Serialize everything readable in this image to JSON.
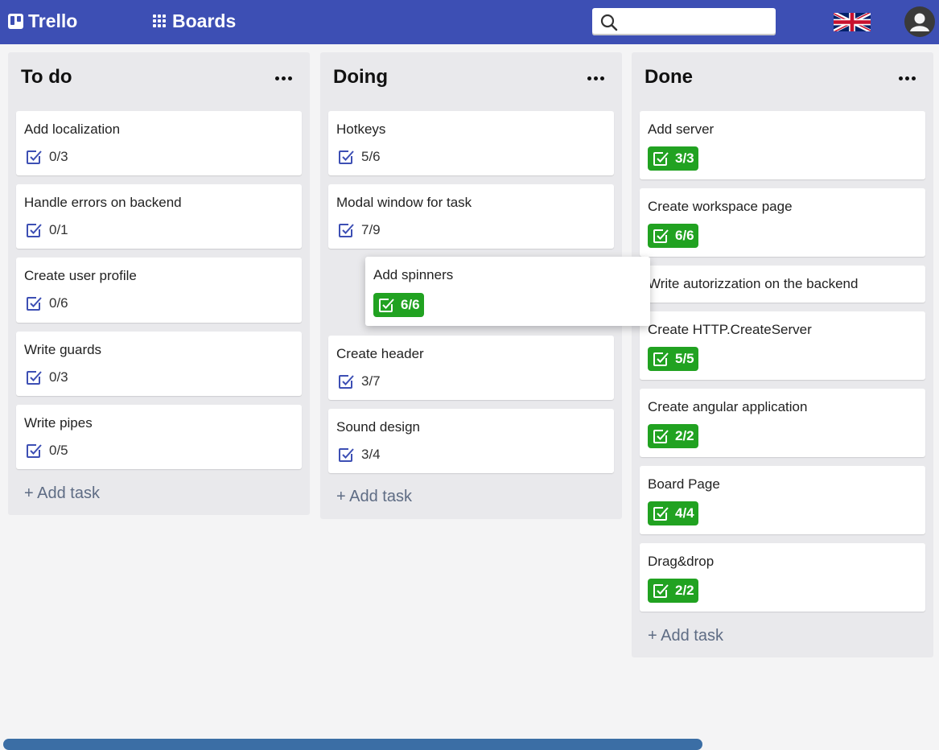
{
  "header": {
    "logo": "Trello",
    "boards": "Boards",
    "search": {
      "value": "",
      "placeholder": ""
    },
    "language_icon": "uk-flag-icon",
    "avatar_icon": "user-avatar-icon",
    "color": "#3d4fb4"
  },
  "columns": [
    {
      "title": "To do",
      "cards": [
        {
          "title": "Add localization",
          "progress": "0/3"
        },
        {
          "title": "Handle errors on backend",
          "progress": "0/1"
        },
        {
          "title": "Create user profile",
          "progress": "0/6"
        },
        {
          "title": "Write guards",
          "progress": "0/3"
        },
        {
          "title": "Write pipes",
          "progress": "0/5"
        }
      ],
      "add_task": "+ Add task"
    },
    {
      "title": "Doing",
      "cards": [
        {
          "title": "Hotkeys",
          "progress": "5/6"
        },
        {
          "title": "Modal window for task",
          "progress": "7/9"
        },
        {
          "title": "Create header",
          "progress": "3/7"
        },
        {
          "title": "Sound design",
          "progress": "3/4"
        }
      ],
      "add_task": "+ Add task"
    },
    {
      "title": "Done",
      "cards": [
        {
          "title": "Add server",
          "progress": "3/3"
        },
        {
          "title": "Create workspace page",
          "progress": "6/6"
        },
        {
          "title": "Write autorizzation on the backend"
        },
        {
          "title": "Create HTTP.CreateServer",
          "progress": "5/5"
        },
        {
          "title": "Create angular application",
          "progress": "2/2"
        },
        {
          "title": "Board Page",
          "progress": "4/4"
        },
        {
          "title": "Drag&drop",
          "progress": "2/2"
        }
      ],
      "add_task": "+ Add task"
    }
  ],
  "dragging_card": {
    "title": "Add spinners",
    "progress": "6/6"
  },
  "colors": {
    "complete": "#21a221",
    "checkbox": "#3d4fb4",
    "scrollbar": "#3b6ea5"
  }
}
